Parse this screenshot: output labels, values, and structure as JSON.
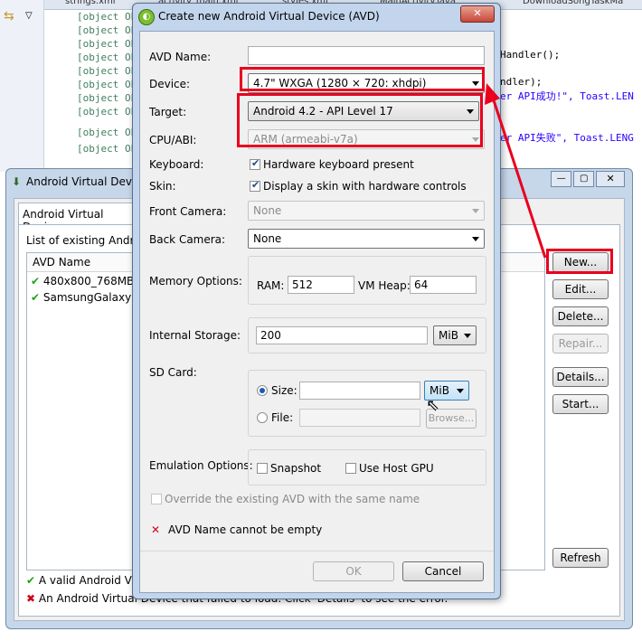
{
  "ide": {
    "tabs": [
      "strings.xml",
      "activity_main.xml",
      "styles.xml",
      "MainActivity.java",
      "DownloadSongTaskMa"
    ],
    "code": [
      {
        "text": "//",
        "cls": ""
      },
      {
        "text": "//",
        "cls": ""
      },
      {
        "text": "//",
        "cls": ""
      },
      {
        "text": "//",
        "cls": ""
      },
      {
        "text": "//",
        "cls": ""
      },
      {
        "text": "//",
        "cls": ""
      },
      {
        "text": "//",
        "cls": ""
      },
      {
        "text": "//",
        "cls": ""
      },
      {
        "text": "//",
        "cls": ""
      },
      {
        "text": "//",
        "cls": ""
      }
    ],
    "right_code": [
      "Handler();",
      "ndler);",
      "er API成功!\", Toast.LEN",
      "er API失败\", Toast.LENG"
    ]
  },
  "parent_window": {
    "title": "Android Virtual Device",
    "tab": "Android Virtual Devices",
    "list_label": "List of existing Android",
    "column_header": "AVD Name",
    "rows": [
      "480x800_768MB",
      "SamsungGalaxySII"
    ],
    "buttons": {
      "new": "New...",
      "edit": "Edit...",
      "delete": "Delete...",
      "repair": "Repair...",
      "details": "Details...",
      "start": "Start...",
      "refresh": "Refresh"
    },
    "legend_valid": "A valid Android Virtu",
    "legend_failed": "An Android Virtual Device that failed to load. Click 'Details' to see the error."
  },
  "dialog": {
    "title": "Create new Android Virtual Device (AVD)",
    "labels": {
      "avd_name": "AVD Name:",
      "device": "Device:",
      "target": "Target:",
      "cpu": "CPU/ABI:",
      "keyboard": "Keyboard:",
      "skin": "Skin:",
      "front_camera": "Front Camera:",
      "back_camera": "Back Camera:",
      "memory": "Memory Options:",
      "ram": "RAM:",
      "vm_heap": "VM Heap:",
      "internal_storage": "Internal Storage:",
      "sd_card": "SD Card:",
      "size": "Size:",
      "file": "File:",
      "emulation": "Emulation Options:"
    },
    "values": {
      "avd_name": "",
      "device": "4.7\" WXGA (1280 × 720: xhdpi)",
      "target": "Android 4.2 - API Level 17",
      "cpu": "ARM (armeabi-v7a)",
      "front_camera": "None",
      "back_camera": "None",
      "ram": "512",
      "vm_heap": "64",
      "internal_storage": "200",
      "internal_unit": "MiB",
      "sd_size": "",
      "sd_unit": "MiB",
      "sd_file": ""
    },
    "checkboxes": {
      "keyboard": "Hardware keyboard present",
      "skin": "Display a skin with hardware controls",
      "snapshot": "Snapshot",
      "host_gpu": "Use Host GPU",
      "override": "Override the existing AVD with the same name"
    },
    "browse": "Browse...",
    "error": "AVD Name cannot be empty",
    "ok": "OK",
    "cancel": "Cancel"
  },
  "colors": {
    "highlight_red": "#e8001e",
    "valid_green": "#1ea31e",
    "error_red": "#d0021b"
  }
}
